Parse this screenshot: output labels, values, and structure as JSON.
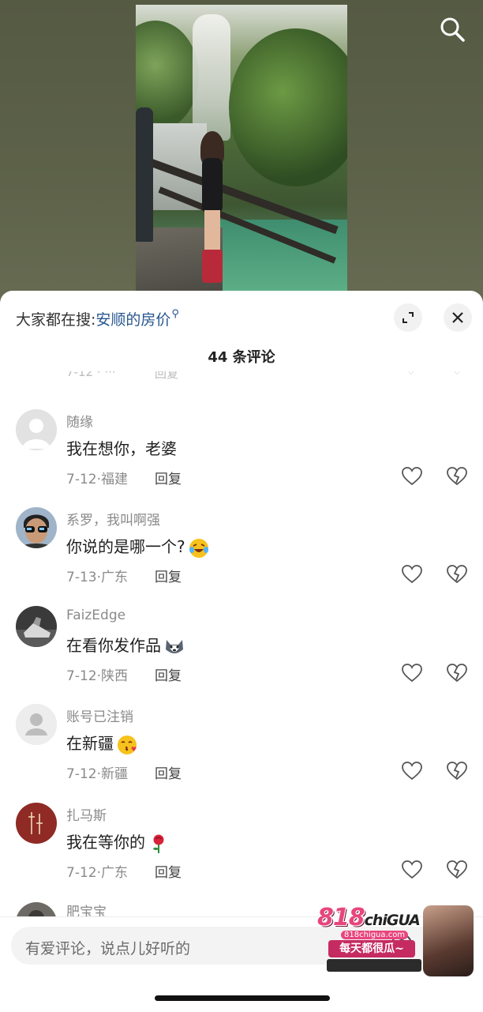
{
  "header": {
    "search_icon": "search-icon"
  },
  "panel": {
    "hot_search_prefix": "大家都在搜:",
    "hot_search_link": "安顺的房价",
    "comment_count": "44",
    "comment_count_suffix": "条评论",
    "icons": {
      "expand": "expand-icon",
      "close": "close-icon"
    }
  },
  "comments": [
    {
      "user": "随缘",
      "text": "我在想你，老婆",
      "emoji": "",
      "date": "7-12",
      "region": "福建",
      "reply": "回复",
      "avatar": "default"
    },
    {
      "user": "系罗，我叫啊强",
      "text": "你说的是哪一个?",
      "emoji": "laughing-tears-emoji",
      "date": "7-13",
      "region": "广东",
      "reply": "回复",
      "avatar": "sunglasses-man"
    },
    {
      "user": "FaizEdge",
      "text": "在看你发作品",
      "emoji": "husky-emoji",
      "date": "7-12",
      "region": "陕西",
      "reply": "回复",
      "avatar": "shoe-photo"
    },
    {
      "user": "账号已注销",
      "text": "在新疆",
      "emoji": "kiss-emoji",
      "date": "7-12",
      "region": "新疆",
      "reply": "回复",
      "avatar": "deleted-user"
    },
    {
      "user": "扎马斯",
      "text": "我在等你的",
      "emoji": "rose-emoji",
      "date": "7-12",
      "region": "广东",
      "reply": "回复",
      "avatar": "red-calligraphy"
    }
  ],
  "partial_comment": {
    "user": "肥宝宝"
  },
  "input": {
    "placeholder": "有爱评论，说点儿好听的",
    "at_icon": "at-icon"
  },
  "watermark": {
    "logo_number": "818",
    "logo_text": "chiGUA",
    "url": "818chigua.com",
    "slogan": "每天都很瓜~"
  },
  "colors": {
    "link": "#27568f",
    "background_top": "#5c6148",
    "watermark_pink": "#e8457d"
  }
}
